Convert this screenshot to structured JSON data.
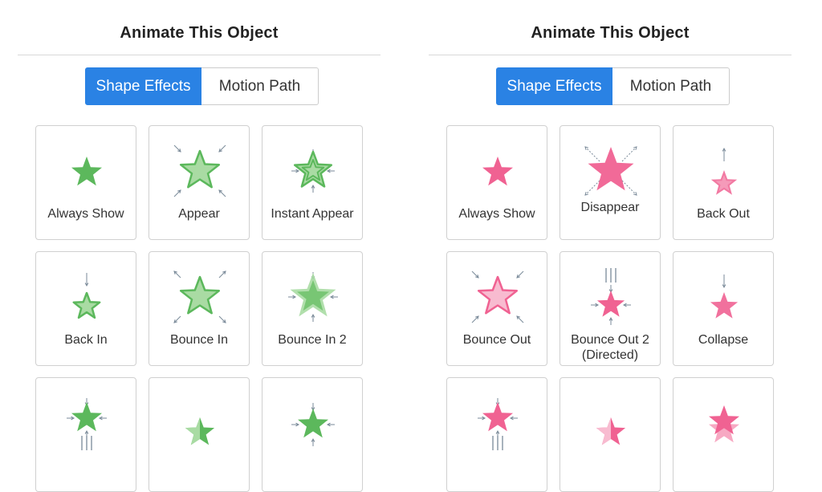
{
  "panels": [
    {
      "title": "Animate This Object",
      "tabs": [
        "Shape Effects",
        "Motion Path"
      ],
      "active_tab": "Shape Effects",
      "accent": "#5cb85c",
      "effects": [
        {
          "label": "Always Show",
          "icon": "star-icon"
        },
        {
          "label": "Appear",
          "icon": "star-appear-icon"
        },
        {
          "label": "Instant Appear",
          "icon": "star-instant-appear-icon"
        },
        {
          "label": "Back In",
          "icon": "star-back-in-icon"
        },
        {
          "label": "Bounce In",
          "icon": "star-bounce-in-icon"
        },
        {
          "label": "Bounce In 2",
          "icon": "star-bounce-in-2-icon"
        },
        {
          "label": "",
          "icon": "star-partial-icon"
        },
        {
          "label": "",
          "icon": "star-half-icon"
        },
        {
          "label": "",
          "icon": "star-converge-icon"
        }
      ]
    },
    {
      "title": "Animate This Object",
      "tabs": [
        "Shape Effects",
        "Motion Path"
      ],
      "active_tab": "Shape Effects",
      "accent": "#f06292",
      "effects": [
        {
          "label": "Always Show",
          "icon": "star-icon"
        },
        {
          "label": "Disappear",
          "icon": "star-disappear-icon"
        },
        {
          "label": "Back Out",
          "icon": "star-back-out-icon"
        },
        {
          "label": "Bounce Out",
          "icon": "star-bounce-out-icon"
        },
        {
          "label": "Bounce Out 2 (Directed)",
          "icon": "star-bounce-out-2-icon"
        },
        {
          "label": "Collapse",
          "icon": "star-collapse-icon"
        },
        {
          "label": "",
          "icon": "star-partial-icon"
        },
        {
          "label": "",
          "icon": "star-half-icon"
        },
        {
          "label": "",
          "icon": "star-stack-icon"
        }
      ]
    }
  ]
}
